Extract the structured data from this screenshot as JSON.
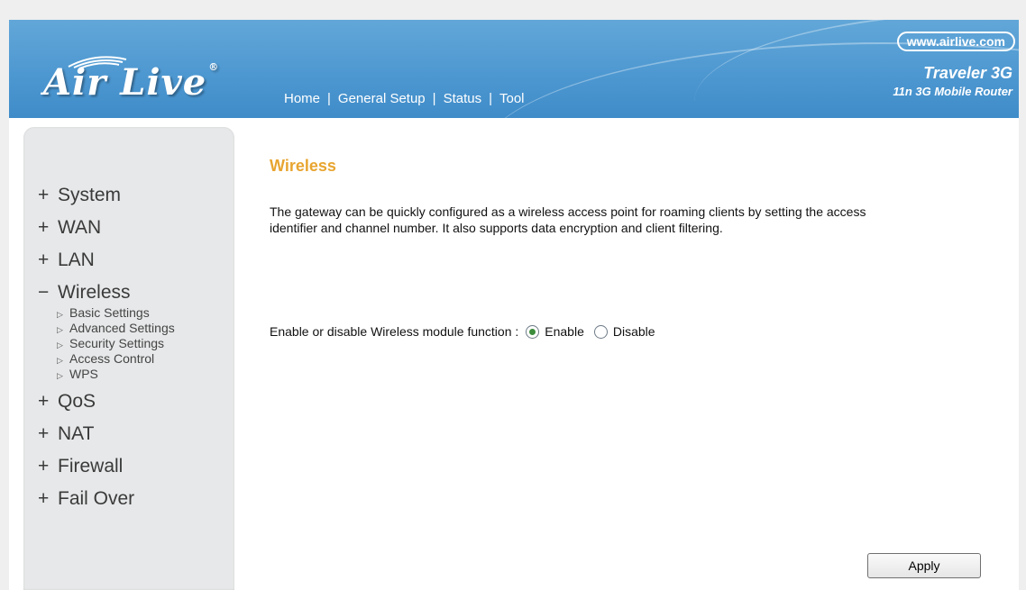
{
  "header": {
    "logo_text": "Air Live",
    "logo_mark": "®",
    "nav": [
      "Home",
      "General Setup",
      "Status",
      "Tool"
    ],
    "nav_separator": "|",
    "brand_url": "www.airlive.com",
    "brand_model": "Traveler 3G",
    "brand_subtitle": "11n 3G Mobile Router"
  },
  "sidebar": {
    "items": [
      {
        "symbol": "+",
        "label": "System"
      },
      {
        "symbol": "+",
        "label": "WAN"
      },
      {
        "symbol": "+",
        "label": "LAN"
      },
      {
        "symbol": "−",
        "label": "Wireless"
      },
      {
        "symbol": "+",
        "label": "QoS"
      },
      {
        "symbol": "+",
        "label": "NAT"
      },
      {
        "symbol": "+",
        "label": "Firewall"
      },
      {
        "symbol": "+",
        "label": "Fail Over"
      }
    ],
    "wireless_subitems": [
      "Basic Settings",
      "Advanced Settings",
      "Security Settings",
      "Access Control",
      "WPS"
    ]
  },
  "content": {
    "title": "Wireless",
    "description": "The gateway can be quickly configured as a wireless access point for roaming clients by setting the access identifier and channel number. It also supports data encryption and client filtering.",
    "option_label": "Enable or disable Wireless module function :",
    "options": [
      {
        "label": "Enable",
        "checked": true
      },
      {
        "label": "Disable",
        "checked": false
      }
    ],
    "apply_label": "Apply"
  },
  "colors": {
    "header_blue": "#4e98d1",
    "title_orange": "#e8a530",
    "sidebar_gray": "#e7e8e9"
  }
}
